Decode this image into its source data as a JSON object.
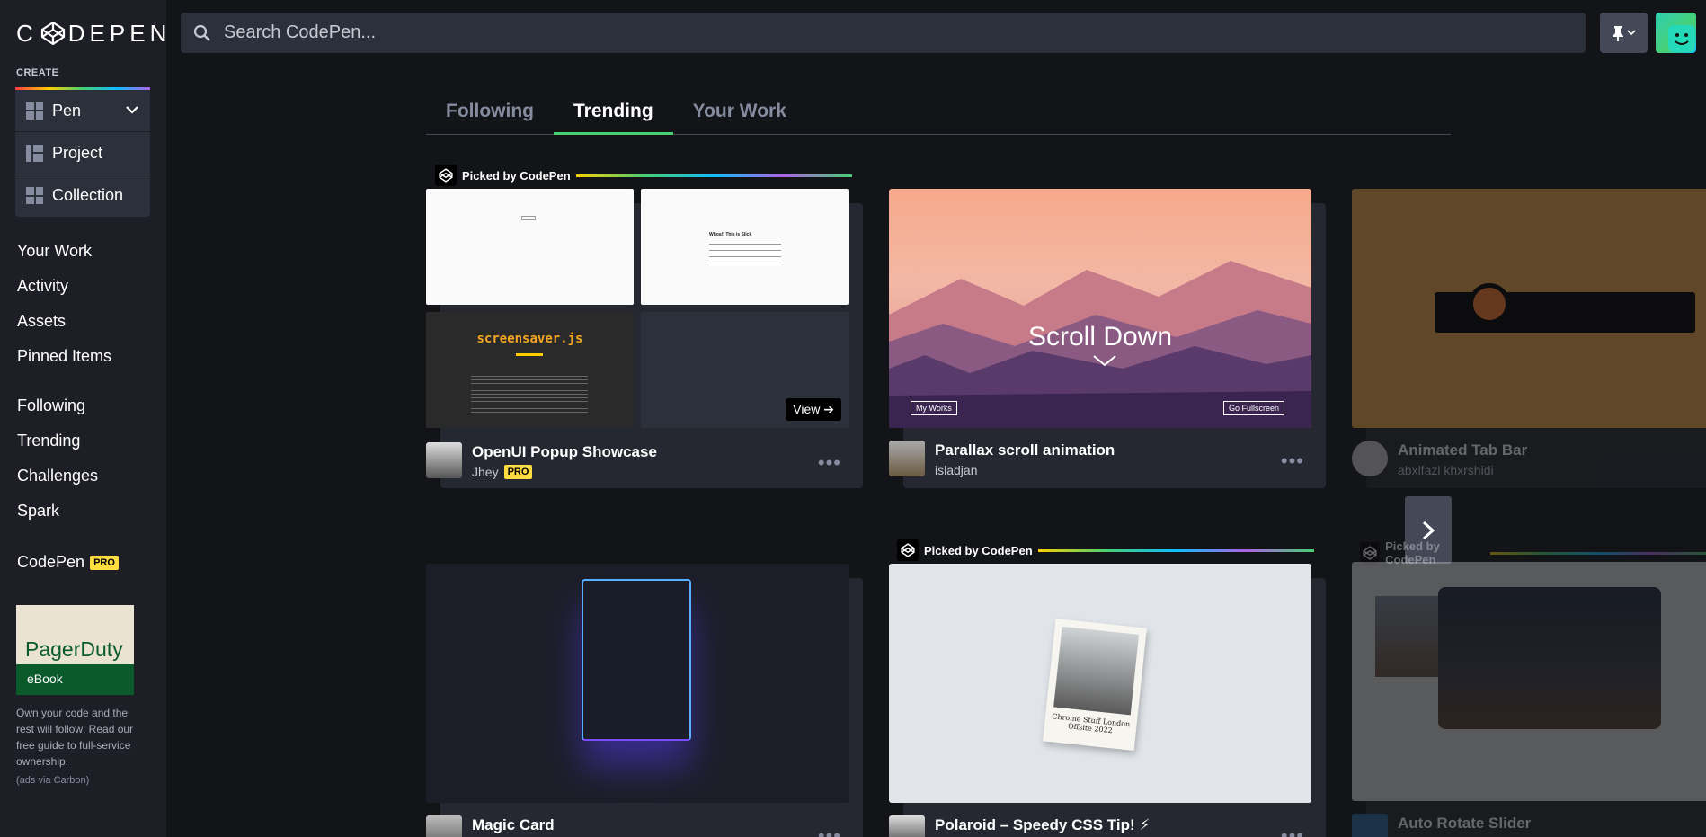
{
  "sidebar": {
    "logo_text": "CODEPEN",
    "create_label": "CREATE",
    "create_items": [
      {
        "label": "Pen"
      },
      {
        "label": "Project"
      },
      {
        "label": "Collection"
      }
    ],
    "nav_group1": [
      "Your Work",
      "Activity",
      "Assets",
      "Pinned Items"
    ],
    "nav_group2": [
      "Following",
      "Trending",
      "Challenges",
      "Spark"
    ],
    "codepen_pro": {
      "label": "CodePen",
      "badge": "PRO"
    },
    "ad": {
      "brand": "PagerDuty",
      "tag": "eBook",
      "text": "Own your code and the rest will follow: Read our free guide to full-service ownership.",
      "via": "(ads via Carbon)"
    }
  },
  "search": {
    "placeholder": "Search CodePen..."
  },
  "tabs": [
    {
      "label": "Following",
      "active": false
    },
    {
      "label": "Trending",
      "active": true
    },
    {
      "label": "Your Work",
      "active": false
    }
  ],
  "picked_label": "Picked by CodePen",
  "cards": [
    {
      "title": "OpenUI Popup Showcase",
      "user": "Jhey",
      "pro": "PRO",
      "picked": true,
      "view_label": "View",
      "screensaver": "screensaver.js",
      "whoa": "Whoa!! This is Slick"
    },
    {
      "title": "Parallax scroll animation",
      "user": "isladjan",
      "scroll_text": "Scroll Down",
      "btn_left": "My Works",
      "btn_right": "Go Fullscreen"
    },
    {
      "title": "Animated Tab Bar",
      "user": "abxlfazl khxrshidi"
    },
    {
      "title": "Magic Card",
      "user": ""
    },
    {
      "title": "Polaroid – Speedy CSS Tip! ⚡",
      "user": "",
      "picked": true,
      "polaroid_caption": "Chrome Stuff London Offsite 2022"
    },
    {
      "title": "Auto Rotate Slider",
      "user": "",
      "picked": true
    }
  ],
  "more_label": "•••",
  "colors": {
    "accent": "#47cf73",
    "pro": "#ffdd40",
    "bg": "#131417",
    "sidebar": "#1e1f26"
  }
}
